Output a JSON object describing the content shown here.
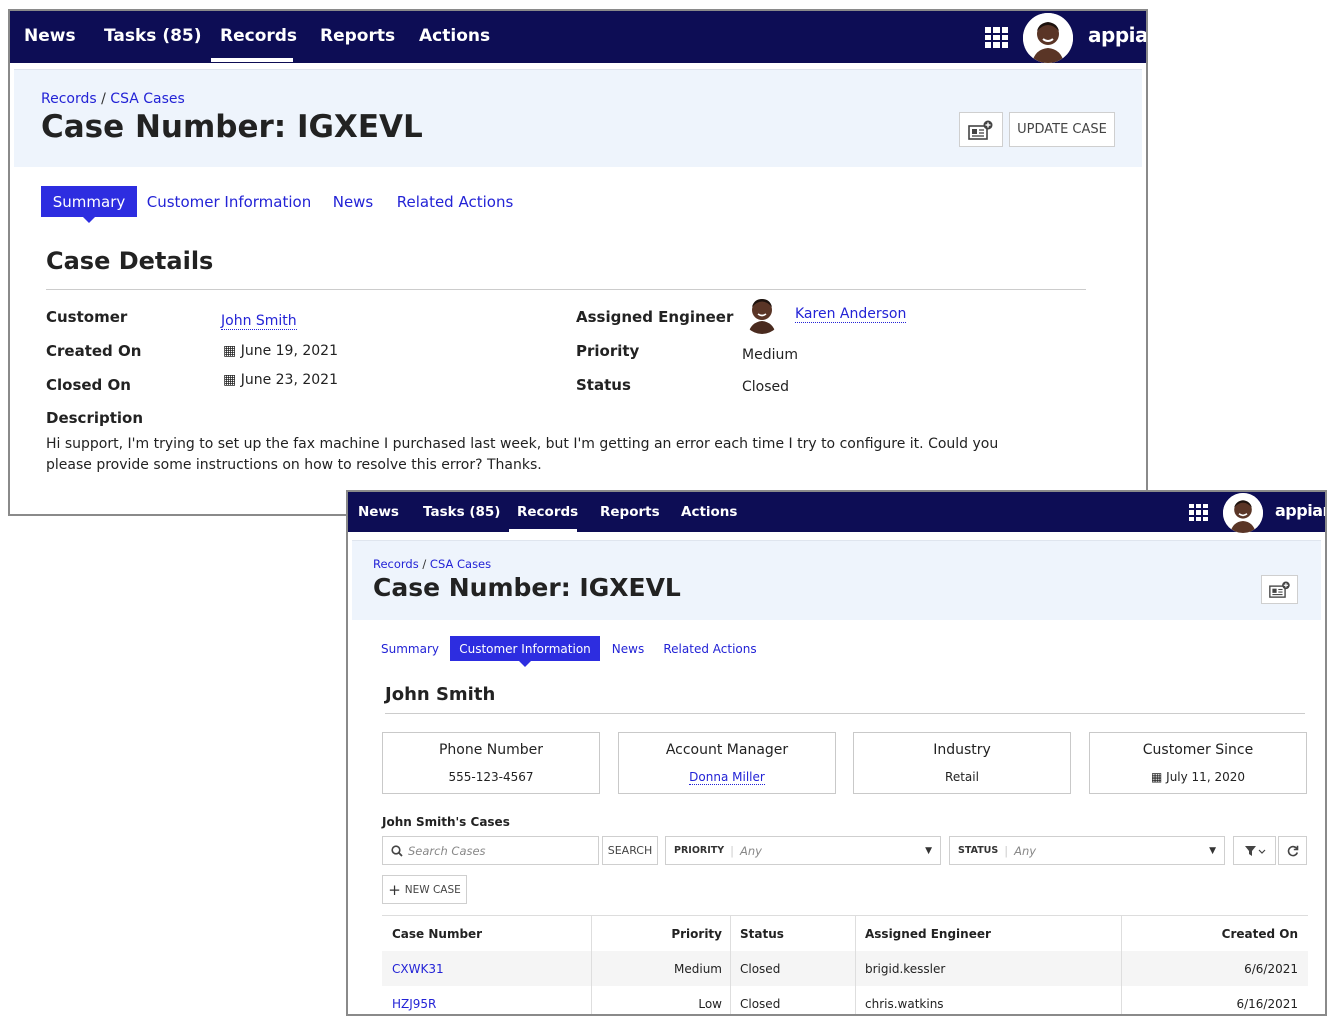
{
  "window1": {
    "nav": {
      "items": [
        "News",
        "Tasks (85)",
        "Records",
        "Reports",
        "Actions"
      ],
      "active": "Records",
      "logo": "appian"
    },
    "breadcrumb": {
      "root": "Records",
      "separator": "/",
      "current": "CSA Cases"
    },
    "title": "Case Number: IGXEVL",
    "update_button": "UPDATE CASE",
    "tabs": [
      "Summary",
      "Customer Information",
      "News",
      "Related Actions"
    ],
    "active_tab": "Summary",
    "section_title": "Case Details",
    "fields": {
      "customer_label": "Customer",
      "customer_value": "John Smith",
      "created_label": "Created On",
      "created_value": "June 19, 2021",
      "closed_label": "Closed On",
      "closed_value": "June 23, 2021",
      "engineer_label": "Assigned Engineer",
      "engineer_value": "Karen Anderson",
      "priority_label": "Priority",
      "priority_value": "Medium",
      "status_label": "Status",
      "status_value": "Closed",
      "description_label": "Description",
      "description_value": "Hi support, I'm trying to set up the fax machine I purchased last week, but I'm getting an error each time I try to configure it. Could you please provide some instructions on how to resolve this error? Thanks."
    }
  },
  "window2": {
    "nav": {
      "items": [
        "News",
        "Tasks (85)",
        "Records",
        "Reports",
        "Actions"
      ],
      "active": "Records",
      "logo": "appian"
    },
    "breadcrumb": {
      "root": "Records",
      "separator": "/",
      "current": "CSA Cases"
    },
    "title": "Case Number: IGXEVL",
    "tabs": [
      "Summary",
      "Customer Information",
      "News",
      "Related Actions"
    ],
    "active_tab": "Customer Information",
    "section_title": "John Smith",
    "cards": [
      {
        "title": "Phone Number",
        "value": "555-123-4567"
      },
      {
        "title": "Account Manager",
        "value": "Donna Miller"
      },
      {
        "title": "Industry",
        "value": "Retail"
      },
      {
        "title": "Customer Since",
        "value": "July 11, 2020"
      }
    ],
    "cases_title": "John Smith's Cases",
    "search_placeholder": "Search Cases",
    "search_button": "SEARCH",
    "priority_filter_label": "PRIORITY",
    "priority_filter_value": "Any",
    "status_filter_label": "STATUS",
    "status_filter_value": "Any",
    "new_case_button": "NEW CASE",
    "table": {
      "headers": [
        "Case Number",
        "Priority",
        "Status",
        "Assigned Engineer",
        "Created On"
      ],
      "rows": [
        [
          "CXWK31",
          "Medium",
          "Closed",
          "brigid.kessler",
          "6/6/2021"
        ],
        [
          "HZJ95R",
          "Low",
          "Closed",
          "chris.watkins",
          "6/16/2021"
        ]
      ]
    }
  },
  "colors": {
    "nav_bg": "#0d0d55",
    "accent": "#2d2de0",
    "link": "#2323d6",
    "header_bg": "#eef4fc"
  }
}
